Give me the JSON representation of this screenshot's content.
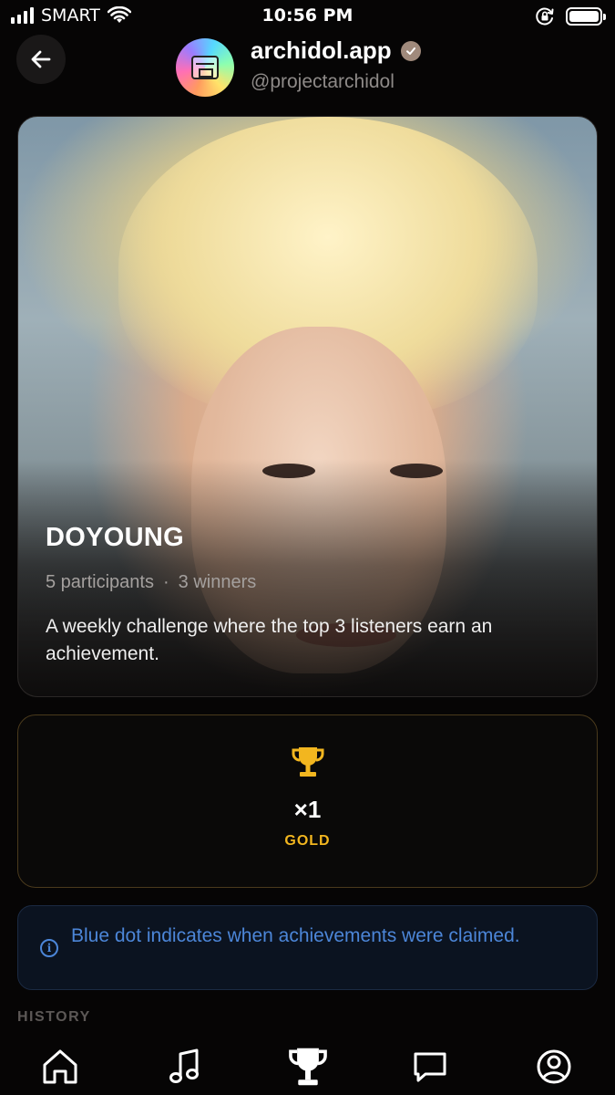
{
  "status_bar": {
    "carrier": "SMART",
    "time": "10:56 PM",
    "icons": [
      "signal-icon",
      "wifi-icon",
      "rotation-lock-icon",
      "battery-icon"
    ]
  },
  "header": {
    "back_icon": "arrow-left-icon",
    "account_name": "archidol.app",
    "verified_icon": "verified-badge-icon",
    "handle": "@projectarchidol"
  },
  "challenge": {
    "title": "DOYOUNG",
    "participants": "5 participants",
    "separator": "·",
    "winners": "3 winners",
    "description": "A weekly challenge where the top 3 listeners earn an achievement."
  },
  "achievement": {
    "icon": "trophy-icon",
    "count": "×1",
    "tier": "GOLD",
    "accent_color": "#f2b61f"
  },
  "info": {
    "icon": "info-icon",
    "text": "Blue dot indicates when achievements were claimed.",
    "color": "#4c86d8"
  },
  "section": {
    "history_label": "HISTORY"
  },
  "bottom_nav": {
    "items": [
      {
        "icon": "home-icon",
        "active": false
      },
      {
        "icon": "music-note-icon",
        "active": false
      },
      {
        "icon": "trophy-icon",
        "active": true
      },
      {
        "icon": "chat-bubble-icon",
        "active": false
      },
      {
        "icon": "profile-icon",
        "active": false
      }
    ]
  }
}
